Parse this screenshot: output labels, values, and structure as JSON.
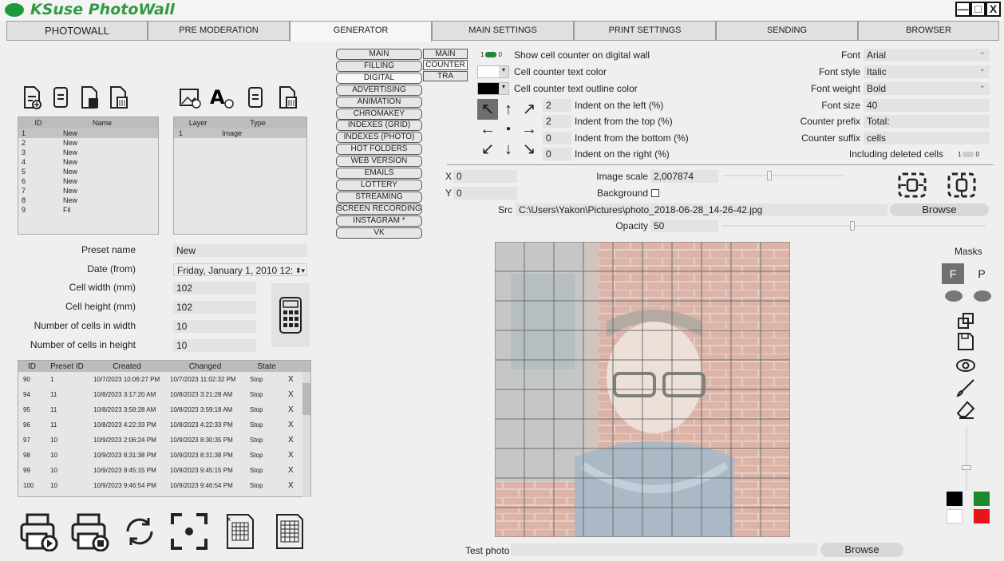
{
  "app": {
    "title": "KSuse PhotoWall"
  },
  "tabs": [
    "PHOTOWALL",
    "PRE MODERATION",
    "GENERATOR",
    "MAIN SETTINGS",
    "PRINT SETTINGS",
    "SENDING",
    "BROWSER"
  ],
  "sidebar_menu": [
    "MAIN",
    "FILLING",
    "DIGITAL",
    "ADVERTISING",
    "ANIMATION",
    "CHROMAKEY",
    "INDEXES (GRID)",
    "INDEXES (PHOTO)",
    "HOT FOLDERS",
    "WEB VERSION",
    "EMAILS",
    "LOTTERY",
    "STREAMING",
    "SCREEN RECORDING",
    "INSTAGRAM *",
    "VK"
  ],
  "sub_menu": [
    "MAIN",
    "COUNTER",
    "TRA"
  ],
  "presets_table": {
    "headers": [
      "ID",
      "Name"
    ],
    "rows": [
      [
        "1",
        "New"
      ],
      [
        "2",
        "New"
      ],
      [
        "3",
        "New"
      ],
      [
        "4",
        "New"
      ],
      [
        "5",
        "New"
      ],
      [
        "6",
        "New"
      ],
      [
        "7",
        "New"
      ],
      [
        "8",
        "New"
      ],
      [
        "9",
        "Fil"
      ]
    ]
  },
  "layers_table": {
    "headers": [
      "Layer",
      "Type"
    ],
    "rows": [
      [
        "1",
        "Image"
      ]
    ]
  },
  "form": {
    "preset_name_label": "Preset name",
    "preset_name": "New",
    "date_label": "Date (from)",
    "date": "Friday, January 1, 2010 12:",
    "cell_width_label": "Cell width (mm)",
    "cell_width": "102",
    "cell_height_label": "Cell height (mm)",
    "cell_height": "102",
    "cells_w_label": "Number of cells in width",
    "cells_w": "10",
    "cells_h_label": "Number of cells in height",
    "cells_h": "10"
  },
  "jobs_table": {
    "headers": [
      "ID",
      "Preset ID",
      "Created",
      "Changed",
      "State"
    ],
    "rows": [
      [
        "90",
        "1",
        "10/7/2023 10:06:27 PM",
        "10/7/2023 11:02:32 PM",
        "Stop"
      ],
      [
        "94",
        "11",
        "10/8/2023 3:17:20 AM",
        "10/8/2023 3:21:28 AM",
        "Stop"
      ],
      [
        "95",
        "11",
        "10/8/2023 3:58:28 AM",
        "10/8/2023 3:59:18 AM",
        "Stop"
      ],
      [
        "96",
        "11",
        "10/8/2023 4:22:33 PM",
        "10/8/2023 4:22:33 PM",
        "Stop"
      ],
      [
        "97",
        "10",
        "10/9/2023 2:06:24 PM",
        "10/9/2023 8:30:35 PM",
        "Stop"
      ],
      [
        "98",
        "10",
        "10/9/2023 8:31:38 PM",
        "10/9/2023 8:31:38 PM",
        "Stop"
      ],
      [
        "99",
        "10",
        "10/9/2023 9:45:15 PM",
        "10/9/2023 9:45:15 PM",
        "Stop"
      ],
      [
        "100",
        "10",
        "10/9/2023 9:46:54 PM",
        "10/9/2023 9:46:54 PM",
        "Stop"
      ]
    ],
    "delete_label": "X"
  },
  "counter": {
    "show_label": "Show cell counter on digital wall",
    "toggle_on": "1",
    "toggle_off": "0",
    "text_color_label": "Cell counter text color",
    "outline_label": "Cell counter text outline color",
    "indent_left_label": "Indent on the left (%)",
    "indent_left": "2",
    "indent_top_label": "Indent from the top (%)",
    "indent_top": "2",
    "indent_bottom_label": "Indent from the bottom (%)",
    "indent_bottom": "0",
    "indent_right_label": "Indent on the right (%)",
    "indent_right": "0",
    "font_label": "Font",
    "font": "Arial",
    "font_style_label": "Font style",
    "font_style": "Italic",
    "font_weight_label": "Font weight",
    "font_weight": "Bold",
    "font_size_label": "Font size",
    "font_size": "40",
    "prefix_label": "Counter prefix",
    "prefix": "Total:",
    "suffix_label": "Counter suffix",
    "suffix": "cells",
    "deleted_label": "Including deleted cells",
    "deleted_on": "1",
    "deleted_off": "0"
  },
  "layer": {
    "x_label": "X",
    "x": "0",
    "y_label": "Y",
    "y": "0",
    "scale_label": "Image scale",
    "scale": "2,007874",
    "background_label": "Background",
    "src_label": "Src",
    "src": "C:\\Users\\Yakon\\Pictures\\photo_2018-06-28_14-26-42.jpg",
    "browse": "Browse",
    "opacity_label": "Opacity",
    "opacity": "50"
  },
  "masks": {
    "title": "Masks",
    "f": "F",
    "p": "P"
  },
  "test_photo": {
    "label": "Test photo",
    "browse": "Browse"
  },
  "colors": {
    "accent": "#1f9a3a",
    "swatches": [
      "#000000",
      "#1a8a2a",
      "#ffffff",
      "#e8141b"
    ]
  }
}
